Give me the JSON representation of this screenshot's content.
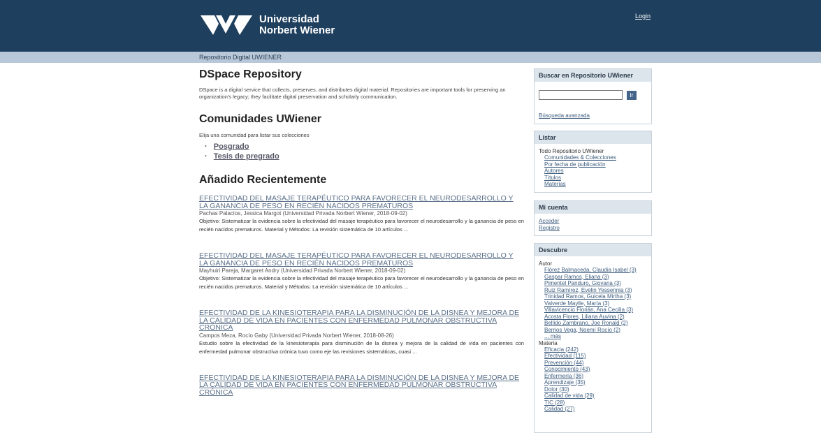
{
  "header": {
    "logo_line1": "Universidad",
    "logo_line2": "Norbert Wiener",
    "login": "Login",
    "colors": {
      "header_bg": "#1e3f5e",
      "trail_bg": "#b9c8d9"
    }
  },
  "breadcrumb": "Repositorio Digital UWIENER",
  "intro": {
    "title": "DSpace Repository",
    "description": "DSpace is a digital service that collects, preserves, and distributes digital material. Repositories are important tools for preserving an organization's legacy; they facilitate digital preservation and scholarly communication."
  },
  "communities": {
    "title": "Comunidades UWiener",
    "hint": "Elija una comunidad para listar sus colecciones",
    "items": [
      "Posgrado",
      "Tesis de pregrado"
    ]
  },
  "recent": {
    "title": "Añadido Recientemente",
    "items": [
      {
        "title": "EFECTIVIDAD DEL MASAJE TERAPÉUTICO PARA FAVORECER EL NEURODESARROLLO Y LA GANANCIA DE PESO EN RECIÉN NACIDOS PREMATUROS",
        "meta": "Pachas Palacios, Jessica Margot (Universidad Privada Norbert Wiener, 2018-09-02)",
        "abstract": "Objetivo: Sistematizar la evidencia sobre la efectividad del masaje terapéutico para favorecer el neurodesarrollo y la ganancia de peso en recién nacidos prematuros. Material y Métodos: La revisión sistemática de 10 artículos ..."
      },
      {
        "title": "EFECTIVIDAD DEL MASAJE TERAPÉUTICO PARA FAVORECER EL NEURODESARROLLO Y LA GANANCIA DE PESO EN RECIÉN NACIDOS PREMATUROS",
        "meta": "Mayhuiri Pareja, Margaret Andry (Universidad Privada Norbert Wiener, 2018-09-02)",
        "abstract": "Objetivo: Sistematizar la evidencia sobre la efectividad del masaje terapéutico para favorecer el neurodesarrollo y la ganancia de peso en recién nacidos prematuros. Material y Métodos: La revisión sistemática de 10 artículos ..."
      },
      {
        "title": "EFECTIVIDAD DE LA KINESIOTERAPIA PARA LA DISMINUCIÓN DE LA DISNEA Y MEJORA DE LA CALIDAD DE VIDA EN PACIENTES CON ENFERMEDAD PULMONAR OBSTRUCTIVA CRÓNICA",
        "meta": "Campos Meza, Rocío Gaby (Universidad Privada Norbert Wiener, 2018-08-26)",
        "abstract": "Estudio sobre la efectividad de la kinesioterapia para disminución de la disnea y mejora de la calidad de vida en pacientes con enfermedad pulmonar obstructiva crónica tuvo como eje las revisiones sistemáticas, cuasi ..."
      },
      {
        "title": "EFECTIVIDAD DE LA KINESIOTERAPIA PARA LA DISMINUCIÓN DE LA DISNEA Y MEJORA DE LA CALIDAD DE VIDA EN PACIENTES CON ENFERMEDAD PULMONAR OBSTRUCTIVA CRÓNICA",
        "meta": "",
        "abstract": ""
      }
    ]
  },
  "sidebar": {
    "search": {
      "title": "Buscar en Repositorio UWiener",
      "button": "Ir",
      "advanced": "Búsqueda avanzada",
      "input_value": ""
    },
    "browse": {
      "title": "Listar",
      "scope": "Todo Repositorio UWiener",
      "links": [
        "Comunidades & Colecciones",
        "Por fecha de publicación",
        "Autores",
        "Títulos",
        "Materias"
      ]
    },
    "account": {
      "title": "Mi cuenta",
      "links": [
        "Acceder",
        "Registro"
      ]
    },
    "discover": {
      "title": "Descubre",
      "author_label": "Autor",
      "authors": [
        "Flórez Balmaceda, Claudia Isabel (3)",
        "Gaspar Ramos, Eliana (3)",
        "Pimentel Panduro, Giovana (3)",
        "Ruiz Ramírez, Evelin Yessennia (3)",
        "Trinidad Ramos, Guicela Mirtha (3)",
        "Valverde Maylle, María (3)",
        "Villavicencio Florián, Ana Cecilia (3)",
        "Acosta Flores, Liliana Auvina (2)",
        "Bellido Zambrano, Joe Ronald (2)",
        "Berrios Vega, Noemí Rocío (2)",
        "... más"
      ],
      "subject_label": "Materia",
      "subjects": [
        "Eficacia (242)",
        "Efectividad (115)",
        "Prevención (44)",
        "Conocimiento (43)",
        "Enfermería (36)",
        "Aprendizaje (35)",
        "Dolor (30)",
        "Calidad de vida (29)",
        "TIC (28)",
        "Calidad (27)"
      ]
    }
  }
}
